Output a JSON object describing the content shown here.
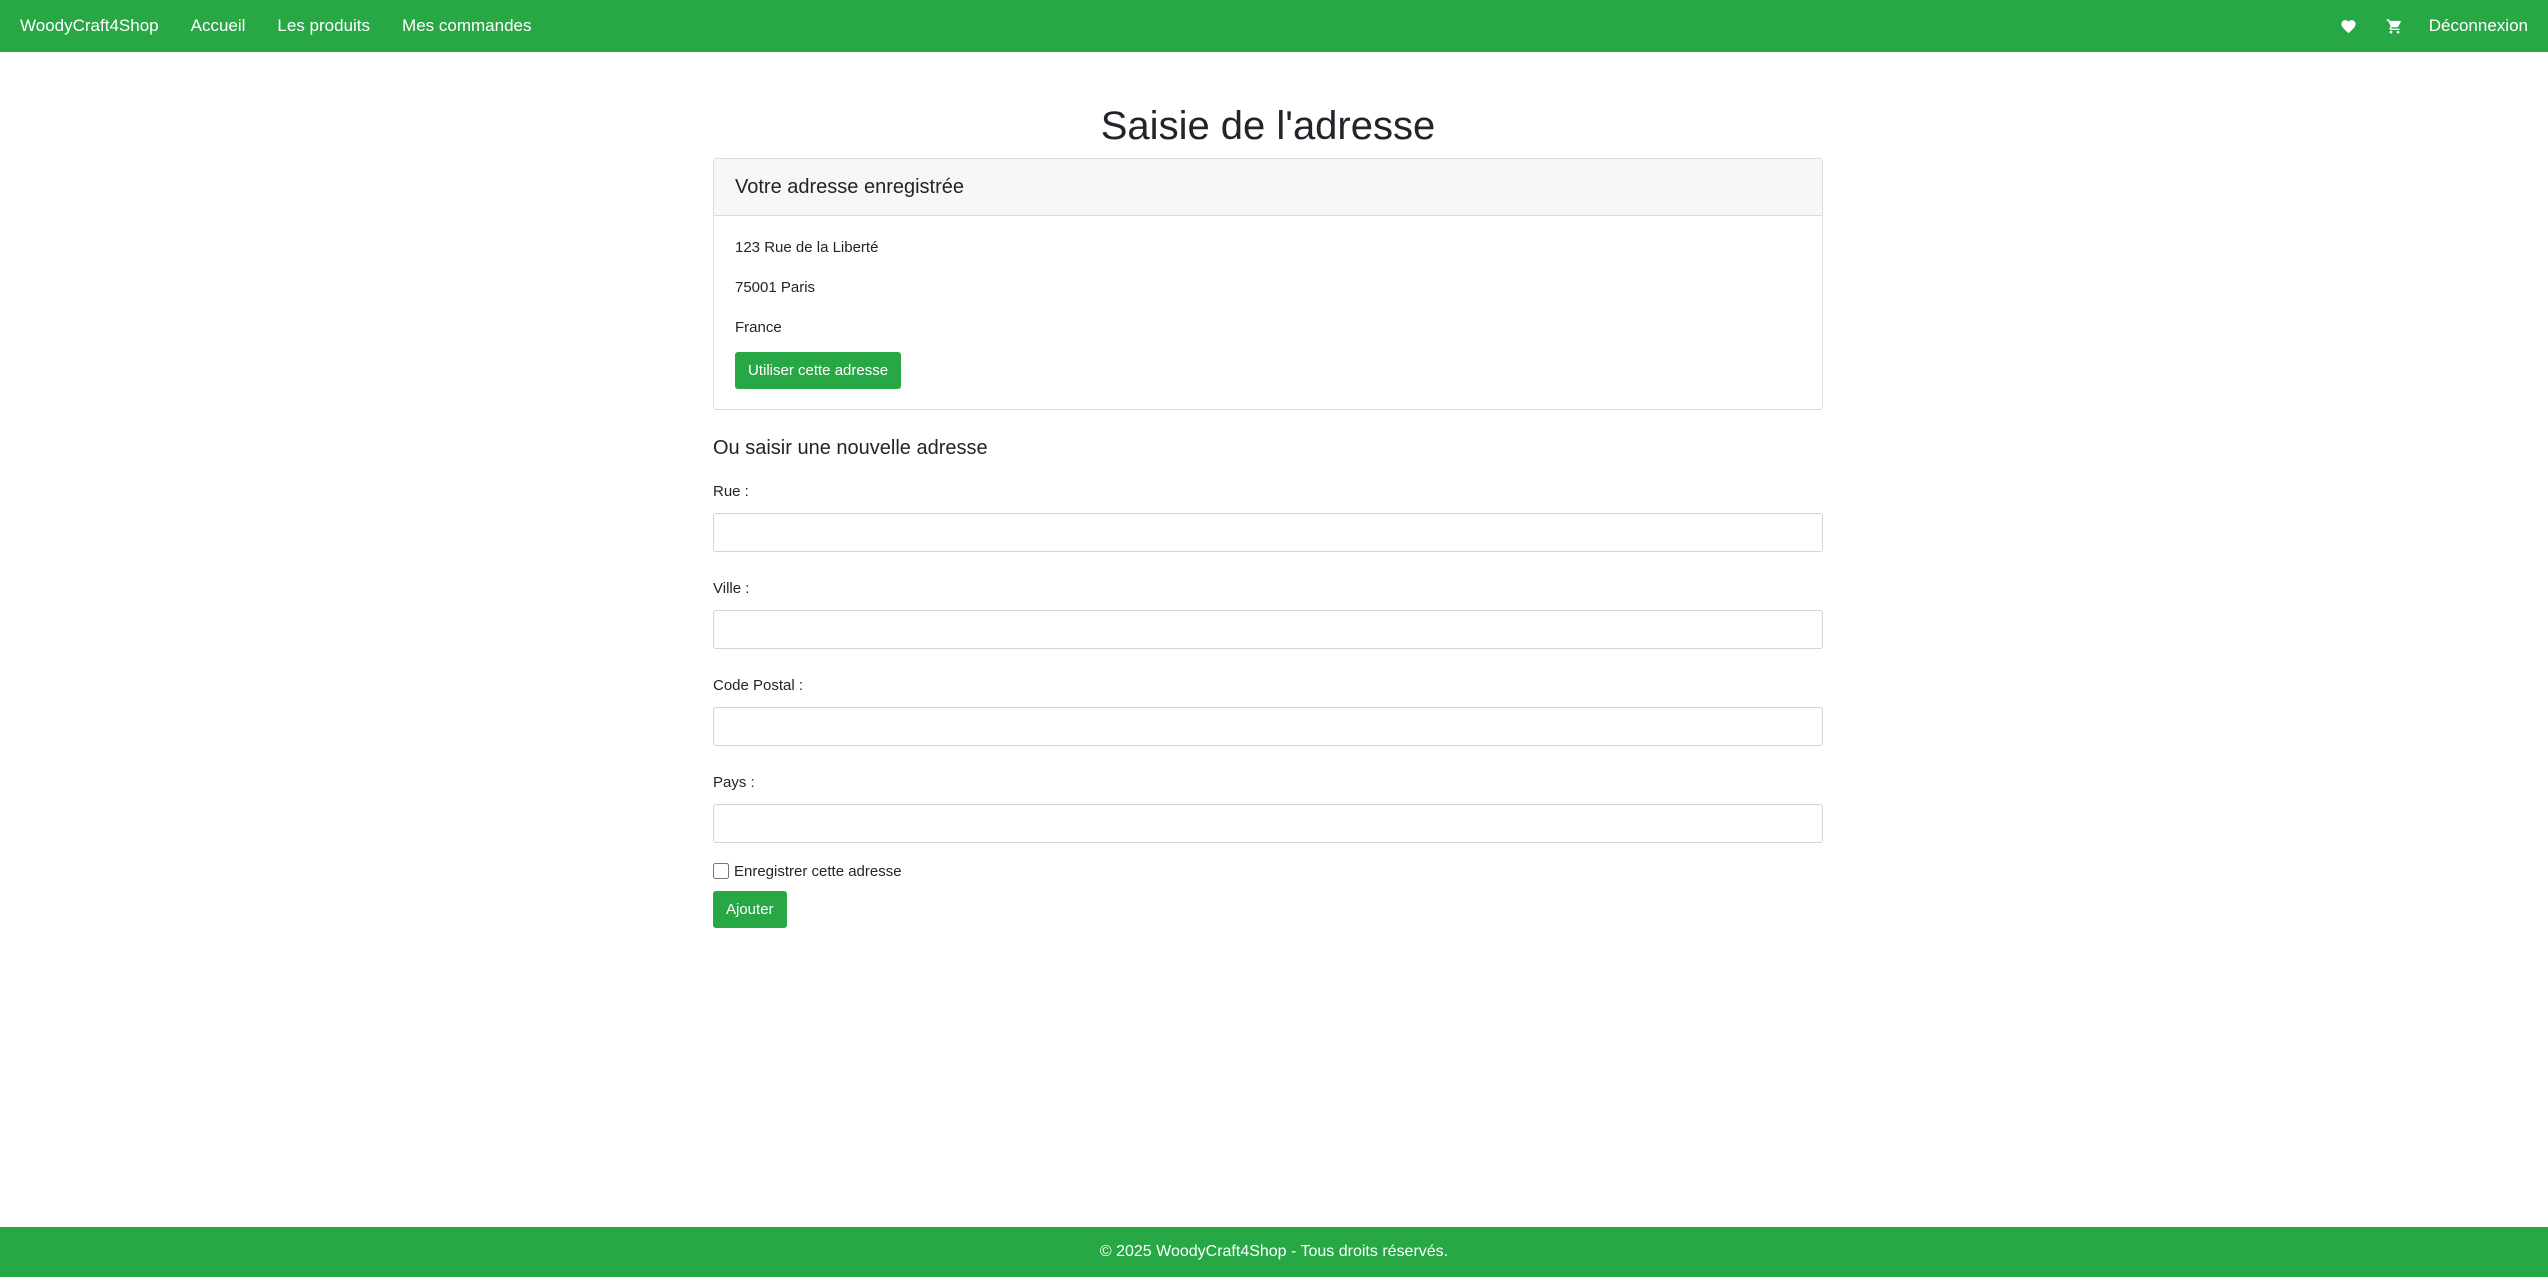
{
  "navbar": {
    "brand": "WoodyCraft4Shop",
    "links": [
      "Accueil",
      "Les produits",
      "Mes commandes"
    ],
    "logout_label": "Déconnexion",
    "icons": [
      "heart-icon",
      "cart-icon"
    ],
    "background_color": "#28a745"
  },
  "page": {
    "title": "Saisie de l'adresse"
  },
  "saved_address": {
    "header": "Votre adresse enregistrée",
    "street": "123 Rue de la Liberté",
    "city_line": "75001 Paris",
    "country": "France",
    "use_button_label": "Utiliser cette adresse"
  },
  "new_address": {
    "title": "Ou saisir une nouvelle adresse",
    "fields": {
      "street_label": "Rue :",
      "street_value": "",
      "city_label": "Ville :",
      "city_value": "",
      "postal_label": "Code Postal :",
      "postal_value": "",
      "country_label": "Pays :",
      "country_value": ""
    },
    "save_checkbox_label": "Enregistrer cette adresse",
    "save_checkbox_checked": false,
    "submit_label": "Ajouter"
  },
  "footer": {
    "text": "© 2025 WoodyCraft4Shop - Tous droits réservés."
  }
}
